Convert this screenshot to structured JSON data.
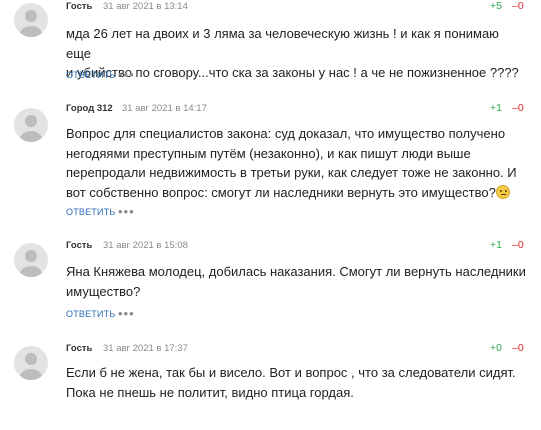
{
  "reply_label": "ОТВЕТИТЬ",
  "more_label": "•••",
  "colors": {
    "vote_up": "#2fa84f",
    "vote_down": "#e02b2b",
    "reply": "#2a6db5"
  },
  "comments": [
    {
      "author": "Гость",
      "date": "31 авг 2021 в 13:14",
      "votes_up": "+5",
      "votes_down": "–0",
      "lines": [
        "мда 26 лет на двоих и 3 ляма за человеческую жизнь ! и как я понимаю еще",
        "и убийство по сговору...что ска за законы у нас ! а че не пожизненное ????"
      ]
    },
    {
      "author": "Город 312",
      "date": "31 авг 2021 в 14:17",
      "votes_up": "+1",
      "votes_down": "–0",
      "lines": [
        "Вопрос для специалистов закона: суд доказал, что имущество получено",
        "негодяями преступным путём (незаконно), и как пишут люди выше",
        "перепродали недвижимость в третьи руки, как следует тоже не законно. И",
        "вот собственно вопрос: смогут ли наследники вернуть это имущество?"
      ],
      "emoji": "smiley-emoji"
    },
    {
      "author": "Гость",
      "date": "31 авг 2021 в 15:08",
      "votes_up": "+1",
      "votes_down": "–0",
      "lines": [
        "Яна Княжева молодец, добилась наказания. Смогут ли вернуть наследники",
        "имущество?"
      ]
    },
    {
      "author": "Гость",
      "date": "31 авг 2021 в 17:37",
      "votes_up": "+0",
      "votes_down": "–0",
      "lines": [
        "Если б не жена, так бы и висело. Вот и вопрос , что за следователи сидят.",
        "Пока не пнешь не политит, видно птица гордая."
      ]
    }
  ]
}
